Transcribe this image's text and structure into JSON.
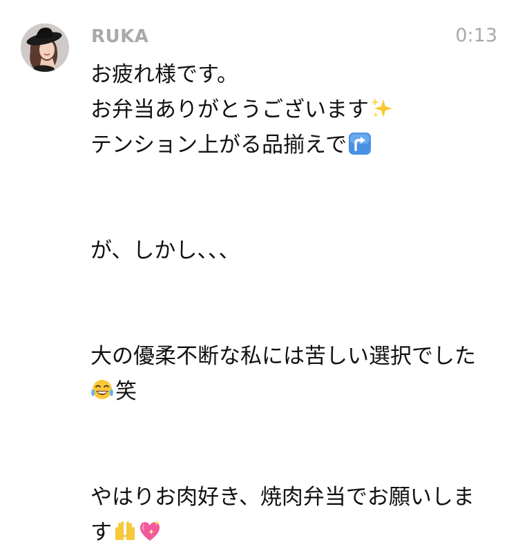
{
  "message": {
    "sender": "RUKA",
    "time": "0:13",
    "avatar_icon": "user-avatar-photo",
    "lines": [
      {
        "text": "お疲れ様です。"
      },
      {
        "text": "お弁当ありがとうございます",
        "emoji": "sparkles-icon"
      },
      {
        "text": "テンション上がる品揃えで",
        "emoji": "arrow-up-right-curved-icon"
      },
      {
        "text": ""
      },
      {
        "text": ""
      },
      {
        "text": "が、しかし、、、"
      },
      {
        "text": ""
      },
      {
        "text": ""
      },
      {
        "text": "大の優柔不断な私には苦しい選択でした"
      },
      {
        "text": "笑",
        "emoji_before": "tears-of-joy-icon"
      },
      {
        "text": ""
      },
      {
        "text": ""
      },
      {
        "text": "やはりお肉好き、焼肉弁当でお願いしま"
      },
      {
        "text": "す",
        "emojis": [
          "raising-hands-icon",
          "sparkling-heart-icon"
        ]
      }
    ]
  },
  "colors": {
    "meta_text": "#a9a9a9",
    "body_text": "#111111",
    "background": "#ffffff"
  }
}
